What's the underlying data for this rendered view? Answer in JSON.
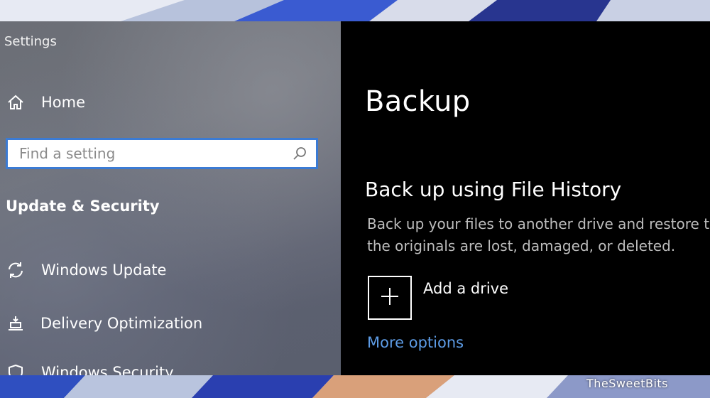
{
  "window": {
    "title": "Settings"
  },
  "sidebar": {
    "home_label": "Home",
    "search": {
      "placeholder": "Find a setting",
      "value": ""
    },
    "section_heading": "Update & Security",
    "items": [
      {
        "label": "Windows Update",
        "icon": "sync-icon"
      },
      {
        "label": "Delivery Optimization",
        "icon": "delivery-optimization-icon"
      },
      {
        "label": "Windows Security",
        "icon": "windows-security-icon"
      }
    ]
  },
  "main": {
    "title": "Backup",
    "file_history": {
      "heading": "Back up using File History",
      "description": "Back up your files to another drive and restore them if the originals are lost, damaged, or deleted.",
      "add_drive_label": "Add a drive",
      "more_options_label": "More options"
    }
  },
  "colors": {
    "accent": "#3b7bd4",
    "link": "#5d9ce6",
    "right_pane_bg": "#000000"
  },
  "watermark": "TheSweetBits"
}
